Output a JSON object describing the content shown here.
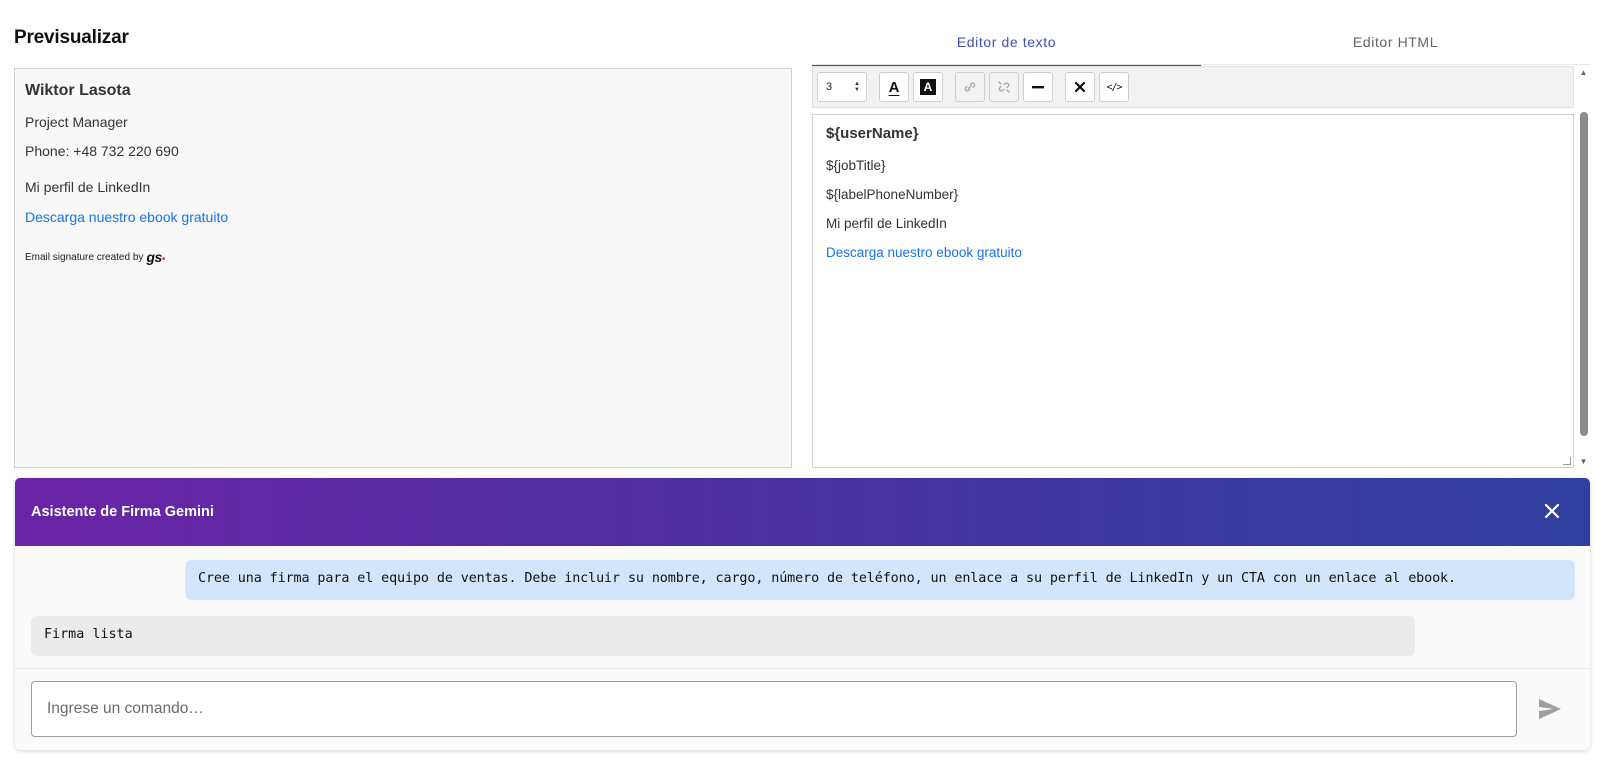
{
  "preview": {
    "title": "Previsualizar",
    "name": "Wiktor Lasota",
    "job_title": "Project Manager",
    "phone": "Phone: +48 732 220 690",
    "linkedin": "Mi perfil de LinkedIn",
    "ebook_link": "Descarga nuestro ebook gratuito",
    "credit": "Email signature created by",
    "credit_logo": "gs"
  },
  "tabs": [
    {
      "label": "Editor de texto",
      "active": true
    },
    {
      "label": "Editor HTML",
      "active": false
    }
  ],
  "toolbar": {
    "font_size": "3",
    "buttons": [
      "text-color-icon",
      "background-color-icon",
      "link-icon",
      "unlink-icon",
      "horizontal-rule-icon",
      "remove-format-icon",
      "code-view-icon"
    ]
  },
  "editor": {
    "name": "${userName}",
    "job_title": "${jobTitle}",
    "phone": "${labelPhoneNumber}",
    "linkedin": "Mi perfil de LinkedIn",
    "ebook_link": "Descarga nuestro ebook gratuito"
  },
  "assistant": {
    "title": "Asistente de Firma Gemini",
    "user_message": "Cree una firma para el equipo de ventas. Debe incluir su nombre, cargo, número de teléfono, un enlace a su perfil de LinkedIn y un CTA con un enlace al ebook.",
    "bot_message": "Firma lista",
    "input_placeholder": "Ingrese un comando…"
  },
  "colors": {
    "accent": "#3f51b5",
    "link": "#1a73e8",
    "header_gradient_start": "#6a24a6",
    "header_gradient_end": "#2f3fa0",
    "user_bubble": "#d2e6fb",
    "bot_bubble": "#ebebeb"
  }
}
